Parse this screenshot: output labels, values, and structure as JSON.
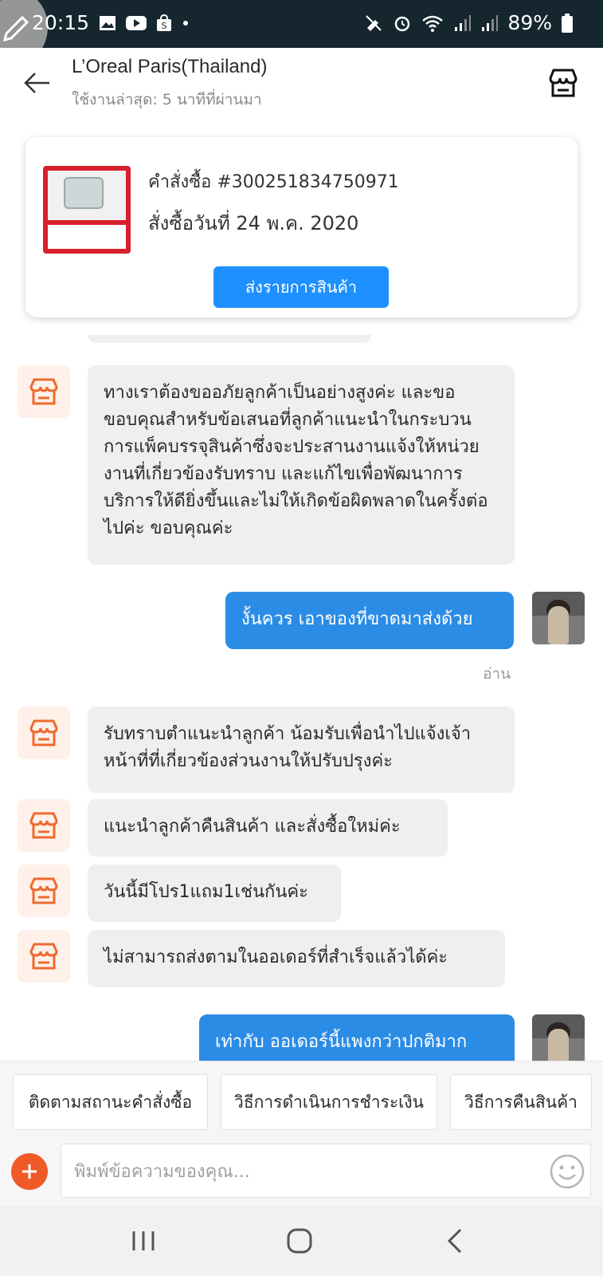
{
  "status_bar": {
    "time": "20:15",
    "battery": "89%",
    "bg_color": "#15262f",
    "left_icons": [
      "gallery-icon",
      "youtube-icon",
      "shopee-bag-icon",
      "dot-icon"
    ],
    "right_icons": [
      "mute-icon",
      "alarm-icon",
      "wifi-icon",
      "signal-icon",
      "signal-icon",
      "battery-icon"
    ]
  },
  "header": {
    "title": "L’Oreal Paris(Thailand)",
    "subtitle": "ใช้งานล่าสุด: 5 นาทีที่ผ่านมา"
  },
  "order_card": {
    "order_number": "คำสั่งซื้อ #300251834750971",
    "order_date": "สั่งซื้อวันที่ 24 พ.ค. 2020",
    "send_button": "ส่งรายการสินค้า"
  },
  "messages": [
    {
      "sender": "shop",
      "text": "ทางเราต้องขออภัยลูกค้าเป็นอย่างสูงค่ะ และขอขอบคุณสำหรับข้อเสนอที่ลูกค้าแนะนำในกระบวนการแพ็คบรรจุสินค้าซึ่งจะประสานงานแจ้งให้หน่วยงานที่เกี่ยวข้องรับทราบ และแก้ไขเพื่อพัฒนาการบริการให้ดียิ่งขึ้นและไม่ให้เกิดข้อผิดพลาดในครั้งต่อไปค่ะ ขอบคุณค่ะ"
    },
    {
      "sender": "user",
      "text": "งั้นควร เอาของที่ขาดมาส่งด้วย",
      "status": "อ่าน"
    },
    {
      "sender": "shop",
      "text": "รับทราบตำแนะนำลูกค้า น้อมรับเพื่อนำไปแจ้งเจ้าหน้าที่ที่เกี่ยวข้องส่วนงานให้ปรับปรุงค่ะ"
    },
    {
      "sender": "shop",
      "text": "แนะนำลูกค้าคืนสินค้า และสั่งซื้อใหม่ค่ะ"
    },
    {
      "sender": "shop",
      "text": "วันนี้มีโปร1แถม1เช่นกันค่ะ"
    },
    {
      "sender": "shop",
      "text": "ไม่สามารถส่งตามในออเดอร์ที่สำเร็จแล้วได้ค่ะ"
    },
    {
      "sender": "user",
      "text": "เท่ากับ ออเดอร์นี้แพงกว่าปกติมาก"
    }
  ],
  "quick_replies": [
    "ติดตามสถานะคำสั่งซื้อ",
    "วิธีการดำเนินการชำระเงิน",
    "วิธีการคืนสินค้า"
  ],
  "input": {
    "placeholder": "พิมพ์ข้อความของคุณ..."
  },
  "colors": {
    "accent_blue": "#2b8ce6",
    "shopee_orange": "#f05a28",
    "bubble_gray": "#efefef"
  }
}
